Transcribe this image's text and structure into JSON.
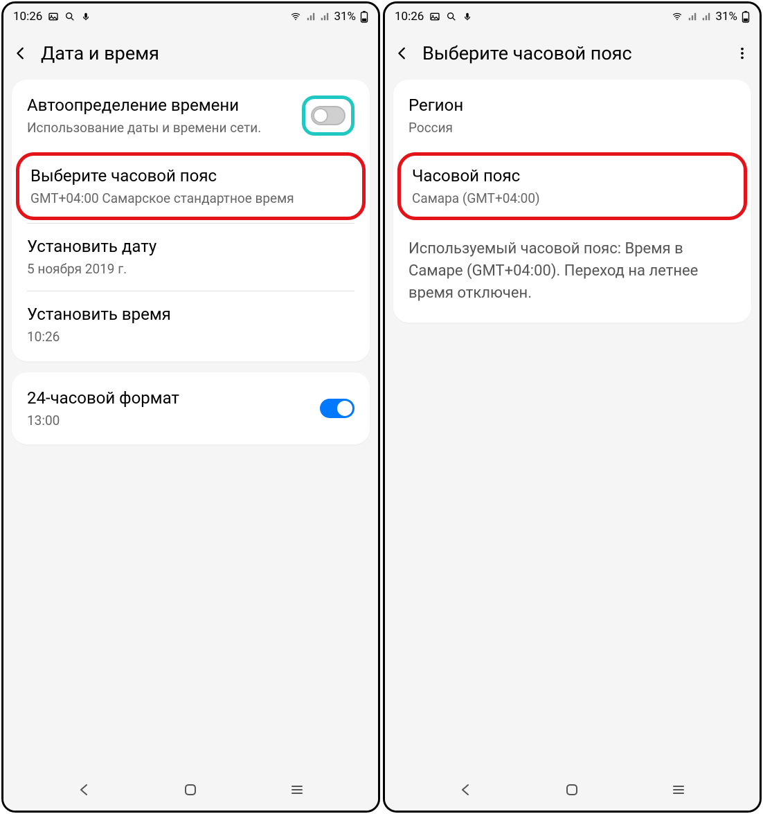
{
  "statusbar": {
    "time": "10:26",
    "battery_text": "31%"
  },
  "screen1": {
    "title": "Дата и время",
    "auto_time": {
      "label": "Автоопределение времени",
      "sub": "Использование даты и времени сети."
    },
    "timezone": {
      "label": "Выберите часовой пояс",
      "sub": "GMT+04:00 Самарское стандартное время"
    },
    "set_date": {
      "label": "Установить дату",
      "sub": "5 ноября 2019 г."
    },
    "set_time": {
      "label": "Установить время",
      "sub": "10:26"
    },
    "format24": {
      "label": "24-часовой формат",
      "sub": "13:00"
    }
  },
  "screen2": {
    "title": "Выберите часовой пояс",
    "region": {
      "label": "Регион",
      "sub": "Россия"
    },
    "timezone": {
      "label": "Часовой пояс",
      "sub": "Самара (GMT+04:00)"
    },
    "info": "Используемый часовой пояс: Время в Самаре (GMT+04:00). Переход на летнее время отключен."
  }
}
